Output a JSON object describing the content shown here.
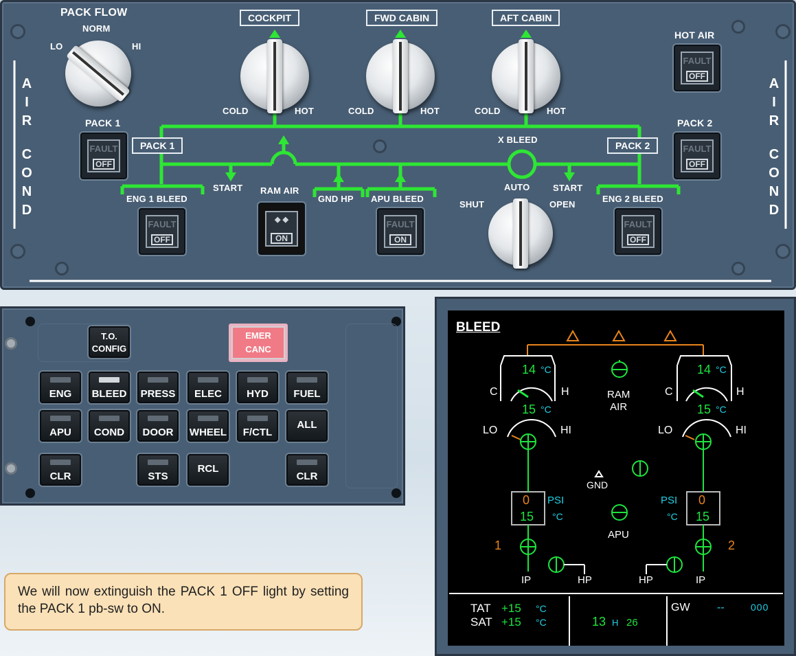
{
  "overhead": {
    "pack_flow": {
      "title": "PACK FLOW",
      "norm": "NORM",
      "lo": "LO",
      "hi": "HI"
    },
    "side_label_letters": [
      "A",
      "I",
      "R",
      "C",
      "O",
      "N",
      "D"
    ],
    "zones": [
      {
        "label": "COCKPIT",
        "cold": "COLD",
        "hot": "HOT"
      },
      {
        "label": "FWD CABIN",
        "cold": "COLD",
        "hot": "HOT"
      },
      {
        "label": "AFT CABIN",
        "cold": "COLD",
        "hot": "HOT"
      }
    ],
    "hot_air": {
      "title": "HOT AIR",
      "fault": "FAULT",
      "state": "OFF"
    },
    "pack1": {
      "title": "PACK 1",
      "duct": "PACK 1",
      "fault": "FAULT",
      "state": "OFF"
    },
    "pack2": {
      "title": "PACK 2",
      "duct": "PACK 2",
      "fault": "FAULT",
      "state": "OFF"
    },
    "xbleed": {
      "title": "X BLEED",
      "auto": "AUTO",
      "shut": "SHUT",
      "open": "OPEN"
    },
    "start_left": "START",
    "start_right": "START",
    "eng1_bleed": {
      "title": "ENG 1 BLEED",
      "fault": "FAULT",
      "state": "OFF"
    },
    "ram_air": {
      "title": "RAM AIR",
      "state": "ON"
    },
    "gnd_hp": "GND HP",
    "apu_bleed": {
      "title": "APU BLEED",
      "fault": "FAULT",
      "state": "ON"
    },
    "eng2_bleed": {
      "title": "ENG 2 BLEED",
      "fault": "FAULT",
      "state": "OFF"
    }
  },
  "ecp": {
    "to_config": [
      "T.O.",
      "CONFIG"
    ],
    "emer_canc": [
      "EMER",
      "CANC"
    ],
    "row1": [
      "ENG",
      "BLEED",
      "PRESS",
      "ELEC",
      "HYD",
      "FUEL"
    ],
    "row2": [
      "APU",
      "COND",
      "DOOR",
      "WHEEL",
      "F/CTL",
      "ALL"
    ],
    "row3": [
      "CLR",
      "STS",
      "RCL",
      "CLR"
    ],
    "active_key": "BLEED"
  },
  "ecam": {
    "page_title": "BLEED",
    "left": {
      "temp_top": "14",
      "temp_unit": "°C",
      "c": "C",
      "h": "H",
      "temp_mid": "15",
      "lo": "LO",
      "hi": "HI",
      "psi": "PSI",
      "psi_val": "0",
      "deg": "°C",
      "deg_val": "15",
      "eng": "1",
      "ip": "IP",
      "hp": "HP"
    },
    "right": {
      "temp_top": "14",
      "temp_unit": "°C",
      "c": "C",
      "h": "H",
      "temp_mid": "15",
      "lo": "LO",
      "hi": "HI",
      "psi": "PSI",
      "psi_val": "0",
      "deg": "°C",
      "deg_val": "15",
      "eng": "2",
      "ip": "IP",
      "hp": "HP"
    },
    "ram_air": [
      "RAM",
      "AIR"
    ],
    "gnd": "GND",
    "apu": "APU",
    "footer": {
      "tat_label": "TAT",
      "tat_val": "+15",
      "sat_label": "SAT",
      "sat_val": "+15",
      "unit": "°C",
      "time_h": "13",
      "time_sep": "H",
      "time_m": "26",
      "gw_label": "GW",
      "gw_dash": "--",
      "gw_box": "000"
    }
  },
  "instruction": "We will now extinguish the PACK 1 OFF light by setting the PACK 1 pb-sw to ON."
}
